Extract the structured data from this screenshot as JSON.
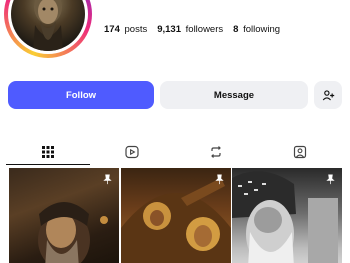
{
  "profile": {
    "stats": [
      {
        "value": "174",
        "label": "posts"
      },
      {
        "value": "9,131",
        "label": "followers"
      },
      {
        "value": "8",
        "label": "following"
      }
    ]
  },
  "actions": {
    "follow_label": "Follow",
    "message_label": "Message",
    "add_icon": "person-add-icon"
  },
  "tabs": [
    {
      "icon": "grid-icon",
      "active": true
    },
    {
      "icon": "reels-icon",
      "active": false
    },
    {
      "icon": "reposts-icon",
      "active": false
    },
    {
      "icon": "tagged-icon",
      "active": false
    }
  ],
  "posts": [
    {
      "pinned": true
    },
    {
      "pinned": true
    },
    {
      "pinned": true
    }
  ],
  "colors": {
    "accent": "#4f5bff",
    "button_bg": "#eff0f3",
    "text": "#111111"
  }
}
